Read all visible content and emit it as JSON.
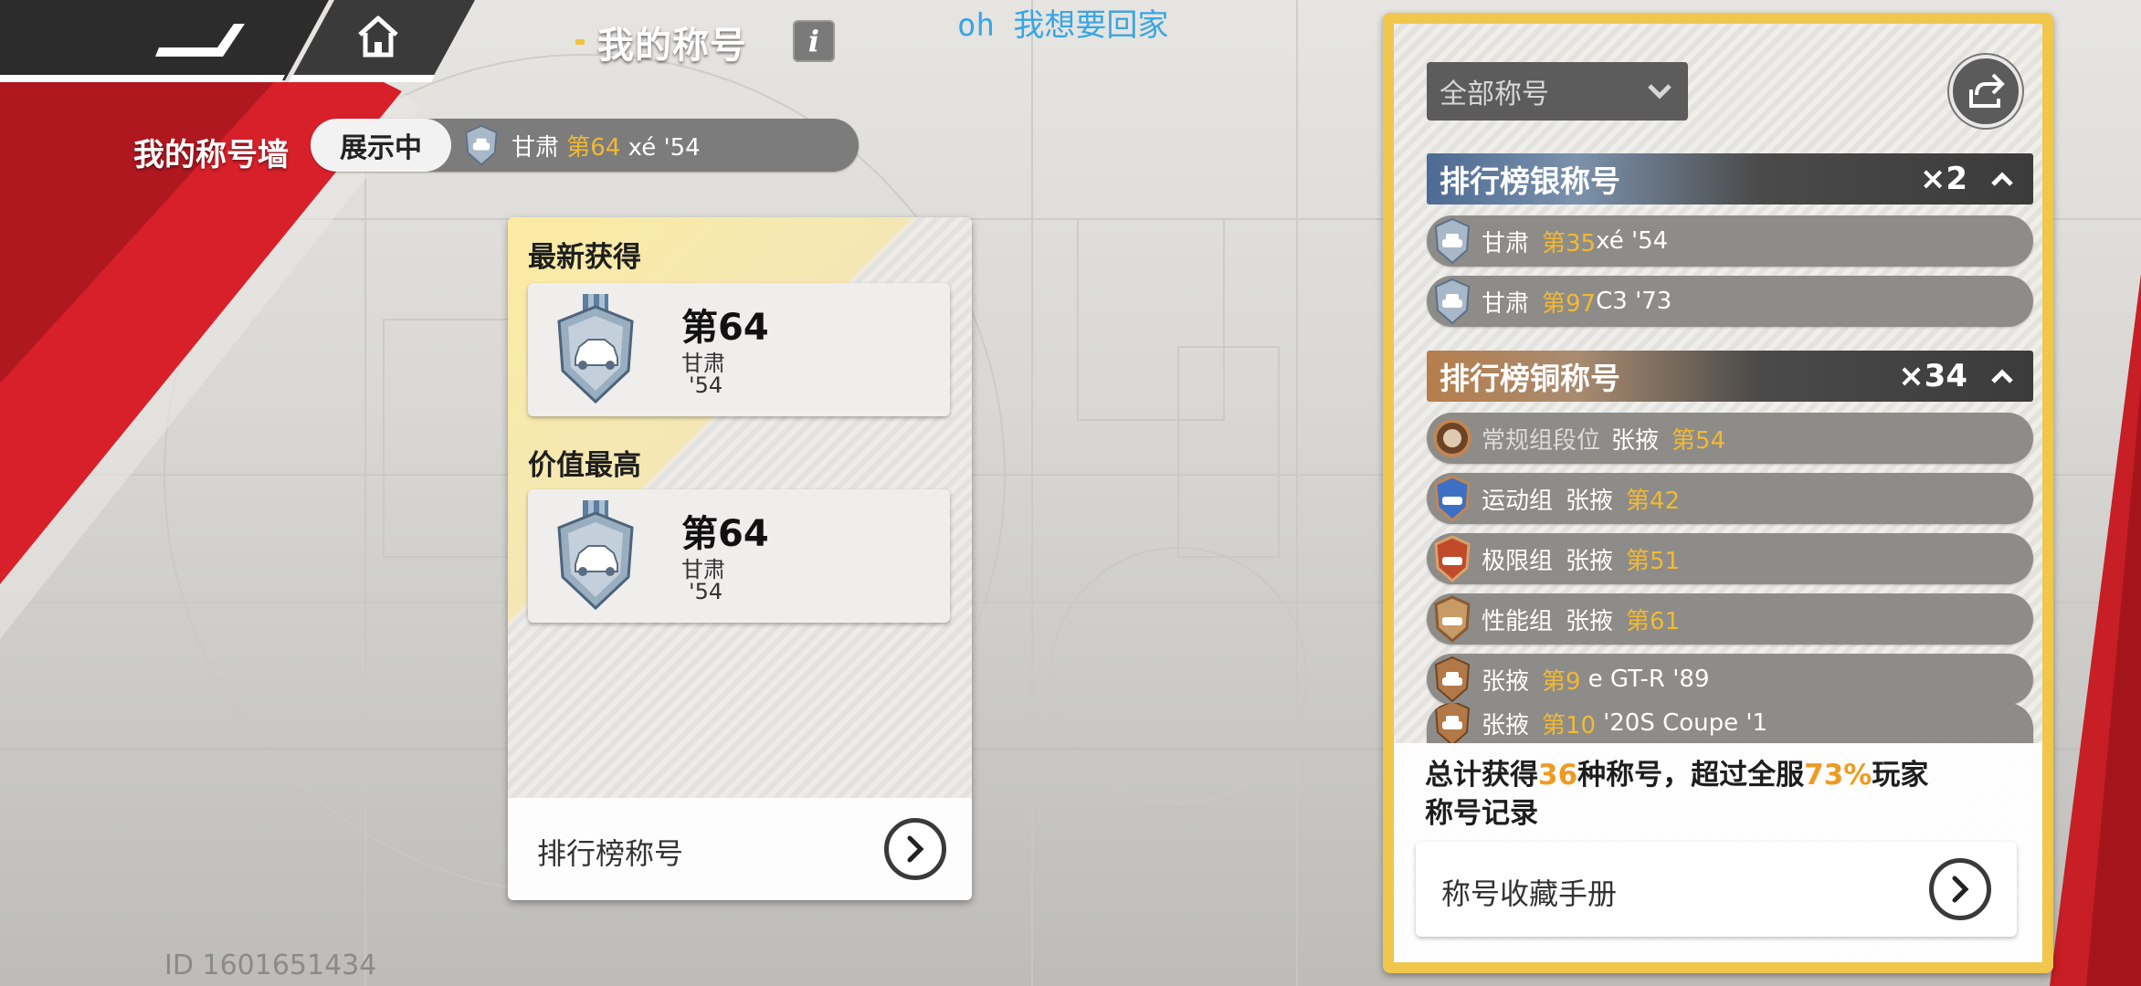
{
  "header": {
    "page_title": "我的称号",
    "info_label": "i",
    "watermark": "oh 我想要回家"
  },
  "wall": {
    "label": "我的称号墙",
    "showing_tag": "展示中",
    "current_region": "甘肃",
    "current_rank": "第64",
    "current_suffix": "xé '54"
  },
  "latest": {
    "section_title": "最新获得",
    "rank": "第64",
    "region": "甘肃",
    "year": "'54"
  },
  "highest": {
    "section_title": "价值最高",
    "rank": "第64",
    "region": "甘肃",
    "year": "'54"
  },
  "mid_footer": {
    "label": "排行榜称号"
  },
  "filter": {
    "label": "全部称号"
  },
  "silver_group": {
    "title": "排行榜银称号",
    "count": "×2",
    "items": [
      {
        "region": "甘肃",
        "rank": "第35",
        "suffix": "xé '54"
      },
      {
        "region": "甘肃",
        "rank": "第97",
        "suffix": "C3 '73"
      }
    ]
  },
  "bronze_group": {
    "title": "排行榜铜称号",
    "count": "×34",
    "items": [
      {
        "prefix": "常规组段位",
        "region": "张掖",
        "rank": "第54",
        "suffix": "",
        "badge": "bronze-ring"
      },
      {
        "prefix": "运动组",
        "region": "张掖",
        "rank": "第42",
        "suffix": "",
        "badge": "blue-shield"
      },
      {
        "prefix": "极限组",
        "region": "张掖",
        "rank": "第51",
        "suffix": "",
        "badge": "red-shield"
      },
      {
        "prefix": "性能组",
        "region": "张掖",
        "rank": "第61",
        "suffix": "",
        "badge": "tan-shield"
      },
      {
        "prefix": "",
        "region": "张掖",
        "rank": "第9",
        "suffix": "e GT-R '89",
        "badge": "bronze-shield"
      },
      {
        "prefix": "",
        "region": "张掖",
        "rank": "第10",
        "suffix": "'20S Coupe '1",
        "badge": "bronze-shield"
      }
    ]
  },
  "summary": {
    "prefix": "总计获得",
    "count": "36",
    "middle": "种称号，超过全服",
    "percent": "73%",
    "suffix": "玩家",
    "line2": "称号记录",
    "button_label": "称号收藏手册"
  },
  "user_id": "ID 1601651434",
  "colors": {
    "accent_gold": "#f2b932",
    "panel_border": "#f1c64d",
    "summary_orange": "#f09a22",
    "red_stripe": "#d8202a"
  },
  "icons": [
    "back-arrow-icon",
    "home-icon",
    "info-icon",
    "chevron-down-icon",
    "share-icon",
    "chevron-up-icon",
    "chevron-right-icon",
    "silver-car-badge-icon",
    "bronze-car-badge-icon"
  ]
}
